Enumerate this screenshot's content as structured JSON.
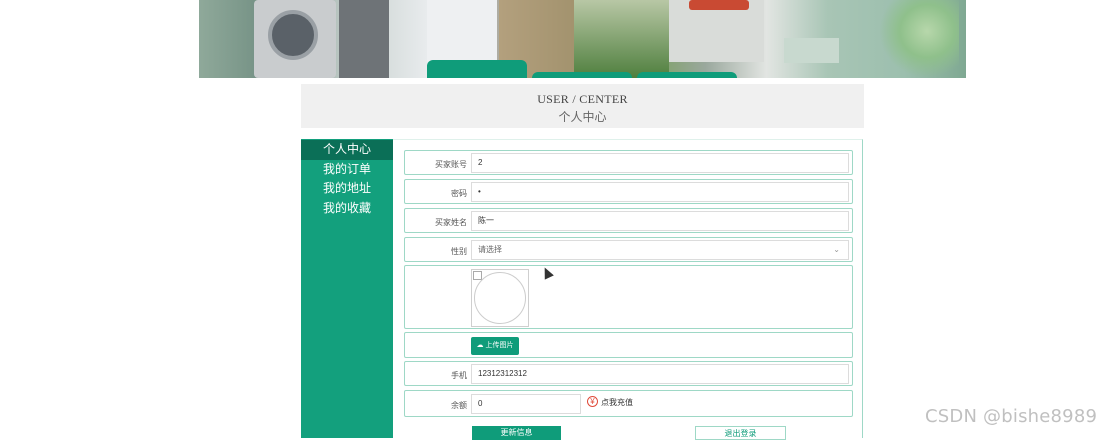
{
  "header": {
    "title_en": "USER / CENTER",
    "title_cn": "个人中心"
  },
  "sidebar": {
    "items": [
      {
        "label": "个人中心",
        "active": true
      },
      {
        "label": "我的订单",
        "active": false
      },
      {
        "label": "我的地址",
        "active": false
      },
      {
        "label": "我的收藏",
        "active": false
      }
    ]
  },
  "form": {
    "account": {
      "label": "买家账号",
      "value": "2"
    },
    "password": {
      "label": "密码",
      "value": "•"
    },
    "name": {
      "label": "买家姓名",
      "value": "陈一"
    },
    "gender": {
      "label": "性别",
      "placeholder": "请选择"
    },
    "upload": {
      "label": "上传图片"
    },
    "phone": {
      "label": "手机",
      "value": "12312312312"
    },
    "balance": {
      "label": "余额",
      "value": "0",
      "recharge": "点我充值"
    }
  },
  "buttons": {
    "update": "更新信息",
    "logout": "退出登录"
  },
  "watermark": "CSDN @bishe8989",
  "colors": {
    "accent": "#0f9c7a",
    "sidebar_active": "#0b6f57",
    "border": "#9ed8c6"
  }
}
